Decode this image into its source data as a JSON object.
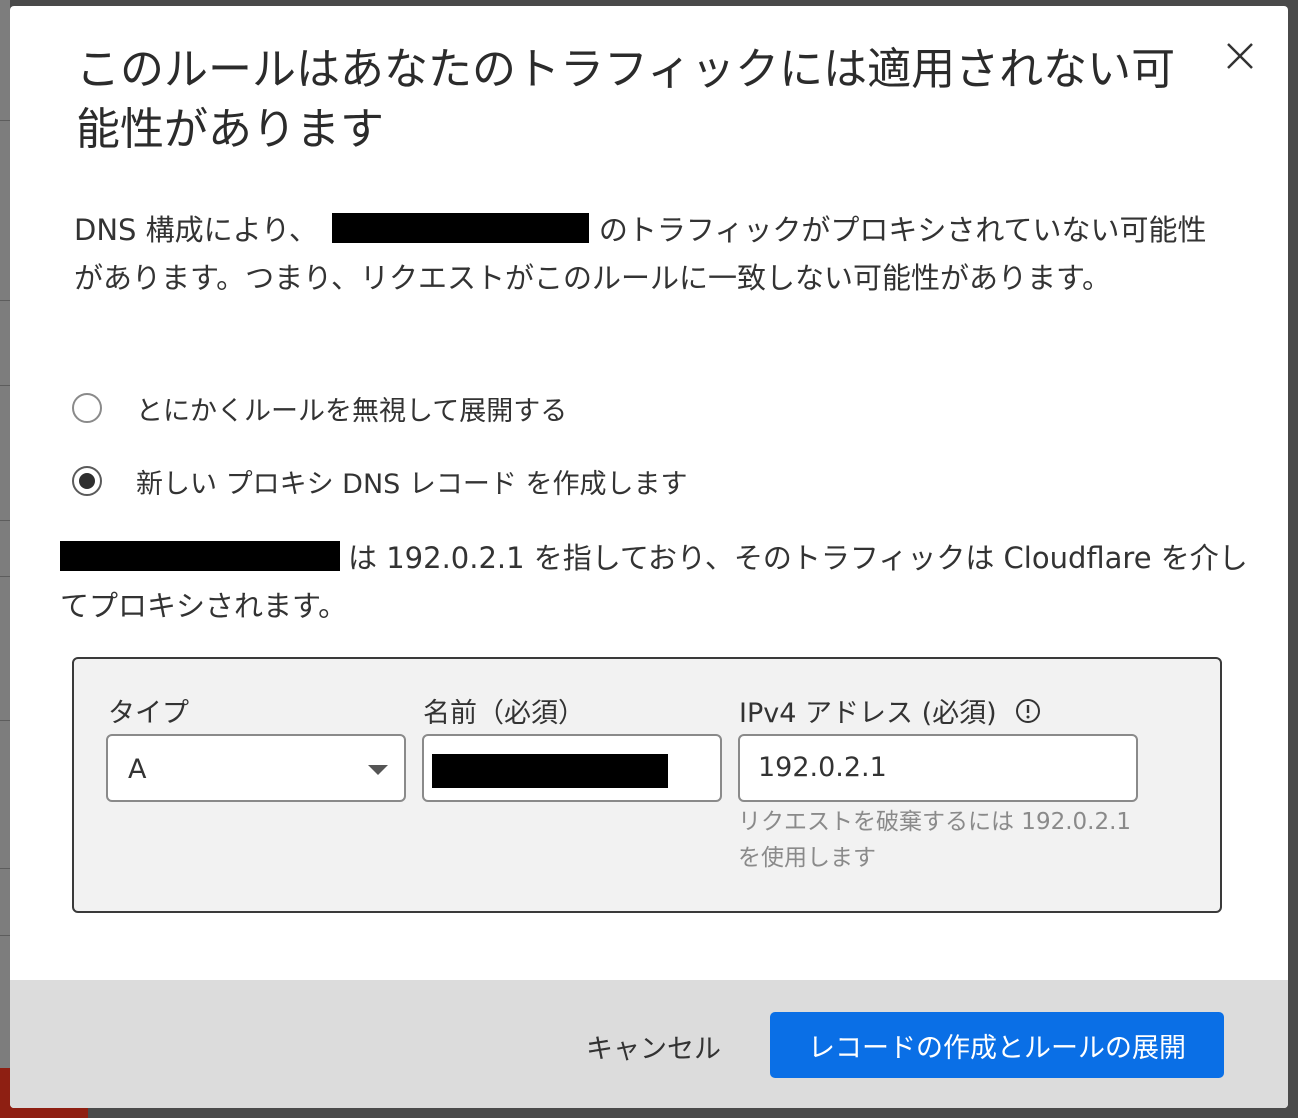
{
  "dialog": {
    "title": "このルールはあなたのトラフィックには適用されない可能性があります",
    "description_prefix": "DNS 構成により、",
    "description_suffix": "のトラフィックがプロキシされていない可能性があります。つまり、リクエストがこのルールに一致しない可能性があります。",
    "options": [
      {
        "label": "とにかくルールを無視して展開する",
        "selected": false
      },
      {
        "label": "新しい プロキシ DNS レコード を作成します",
        "selected": true
      }
    ],
    "info_suffix": "は 192.0.2.1 を指しており、そのトラフィックは Cloudflare を介してプロキシされます。",
    "form": {
      "type_label": "タイプ",
      "type_value": "A",
      "name_label": "名前（必須）",
      "ipv4_label": "IPv4 アドレス (必須)",
      "ipv4_value": "192.0.2.1",
      "ipv4_hint": "リクエストを破棄するには 192.0.2.1 を使用します"
    },
    "footer": {
      "cancel_label": "キャンセル",
      "confirm_label": "レコードの作成とルールの展開"
    }
  },
  "colors": {
    "primary": "#0a6fe6",
    "footer_bg": "#dcdcdc",
    "form_bg": "#f2f2f2"
  }
}
